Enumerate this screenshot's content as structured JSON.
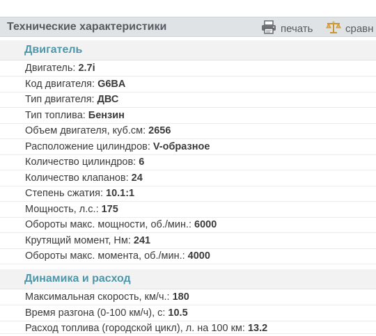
{
  "header": {
    "title": "Технические характеристики",
    "print_label": "печать",
    "compare_label": "сравн",
    "print_icon": "printer-icon",
    "compare_icon": "scales-icon"
  },
  "sections": [
    {
      "title": "Двигатель",
      "rows": [
        {
          "label": "Двигатель:",
          "value": "2.7i"
        },
        {
          "label": "Код двигателя:",
          "value": "G6BA"
        },
        {
          "label": "Тип двигателя:",
          "value": "ДВС"
        },
        {
          "label": "Тип топлива:",
          "value": "Бензин"
        },
        {
          "label": "Объем двигателя, куб.см:",
          "value": "2656"
        },
        {
          "label": "Расположение цилиндров:",
          "value": "V-образное"
        },
        {
          "label": "Количество цилиндров:",
          "value": "6"
        },
        {
          "label": "Количество клапанов:",
          "value": "24"
        },
        {
          "label": "Степень сжатия:",
          "value": "10.1:1"
        },
        {
          "label": "Мощность, л.с.:",
          "value": "175"
        },
        {
          "label": "Обороты макс. мощности, об./мин.:",
          "value": "6000"
        },
        {
          "label": "Крутящий момент, Нм:",
          "value": "241"
        },
        {
          "label": "Обороты макс. момента, об./мин.:",
          "value": "4000"
        }
      ]
    },
    {
      "title": "Динамика и расход",
      "rows": [
        {
          "label": "Максимальная скорость, км/ч.:",
          "value": "180"
        },
        {
          "label": "Время разгона (0-100 км/ч), с:",
          "value": "10.5"
        },
        {
          "label": "Расход топлива (городской цикл), л. на 100 км:",
          "value": "13.2"
        }
      ]
    }
  ],
  "colors": {
    "header_bg": "#dfe3e6",
    "section_bg": "#f2f2f2",
    "section_title": "#4c97aa",
    "compare_icon": "#d9a640"
  }
}
